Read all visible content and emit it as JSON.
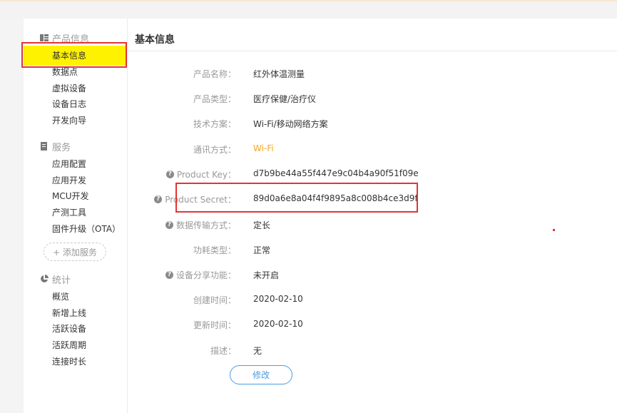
{
  "sidebar": {
    "product_section": {
      "title": "产品信息",
      "icon": "grid-chart-icon",
      "items": [
        {
          "label": "基本信息",
          "active": true
        },
        {
          "label": "数据点"
        },
        {
          "label": "虚拟设备"
        },
        {
          "label": "设备日志"
        },
        {
          "label": "开发向导"
        }
      ]
    },
    "service_section": {
      "title": "服务",
      "icon": "document-icon",
      "items": [
        {
          "label": "应用配置"
        },
        {
          "label": "应用开发"
        },
        {
          "label": "MCU开发"
        },
        {
          "label": "产测工具"
        },
        {
          "label": "固件升级（OTA）"
        }
      ],
      "add_button": "+ 添加服务"
    },
    "stats_section": {
      "title": "统计",
      "icon": "pie-chart-icon",
      "items": [
        {
          "label": "概览"
        },
        {
          "label": "新增上线"
        },
        {
          "label": "活跃设备"
        },
        {
          "label": "活跃周期"
        },
        {
          "label": "连接时长"
        }
      ]
    }
  },
  "main": {
    "title": "基本信息",
    "fields": [
      {
        "label": "产品名称：",
        "value": "红外体温测量",
        "help": false
      },
      {
        "label": "产品类型：",
        "value": "医疗保健/治疗仪",
        "help": false
      },
      {
        "label": "技术方案：",
        "value": "Wi-Fi/移动网络方案",
        "help": false
      },
      {
        "label": "通讯方式：",
        "value": "Wi-Fi",
        "help": false,
        "highlight": true
      },
      {
        "label": "Product Key：",
        "value": "d7b9be44a55f447e9c04b4a90f51f09e",
        "help": true
      },
      {
        "label": "Product Secret：",
        "value": "89d0a6e8a04f4f9895a8c008b4ce3d9f",
        "help": true
      },
      {
        "label": "数据传输方式：",
        "value": "定长",
        "help": true
      },
      {
        "label": "功耗类型：",
        "value": "正常",
        "help": false
      },
      {
        "label": "设备分享功能：",
        "value": "未开启",
        "help": true
      },
      {
        "label": "创建时间：",
        "value": "2020-02-10",
        "help": false
      },
      {
        "label": "更新时间：",
        "value": "2020-02-10",
        "help": false
      },
      {
        "label": "描述：",
        "value": "无",
        "help": false
      }
    ],
    "edit_button": "修改"
  },
  "colors": {
    "active_highlight": "#fff200",
    "annotation_red": "#e23434",
    "link_orange": "#f5a623",
    "button_blue": "#4a9de0"
  }
}
